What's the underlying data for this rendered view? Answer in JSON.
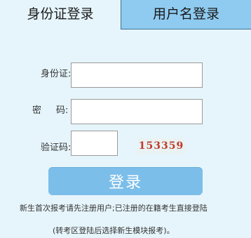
{
  "tabs": [
    {
      "label": "身份证登录",
      "active": true
    },
    {
      "label": "用户名登录",
      "active": false
    }
  ],
  "form": {
    "id_label": "身份证:",
    "password_label_a": "密",
    "password_label_b": "码:",
    "captcha_label": "验证码:",
    "id_value": "",
    "password_value": "",
    "captcha_value": "",
    "captcha_text": "153359"
  },
  "login_button": "登录",
  "notes": {
    "line1": "新生首次报考请先注册用户;已注册的在籍考生直接登陆",
    "line2": "(转考区登陆后选择新生模块报考)。"
  },
  "colors": {
    "panel_bg": "#e6f5fb",
    "inactive_tab_bg": "#8fcbf0",
    "button_bg": "#7cbeea",
    "captcha_text": "#c0392b"
  }
}
